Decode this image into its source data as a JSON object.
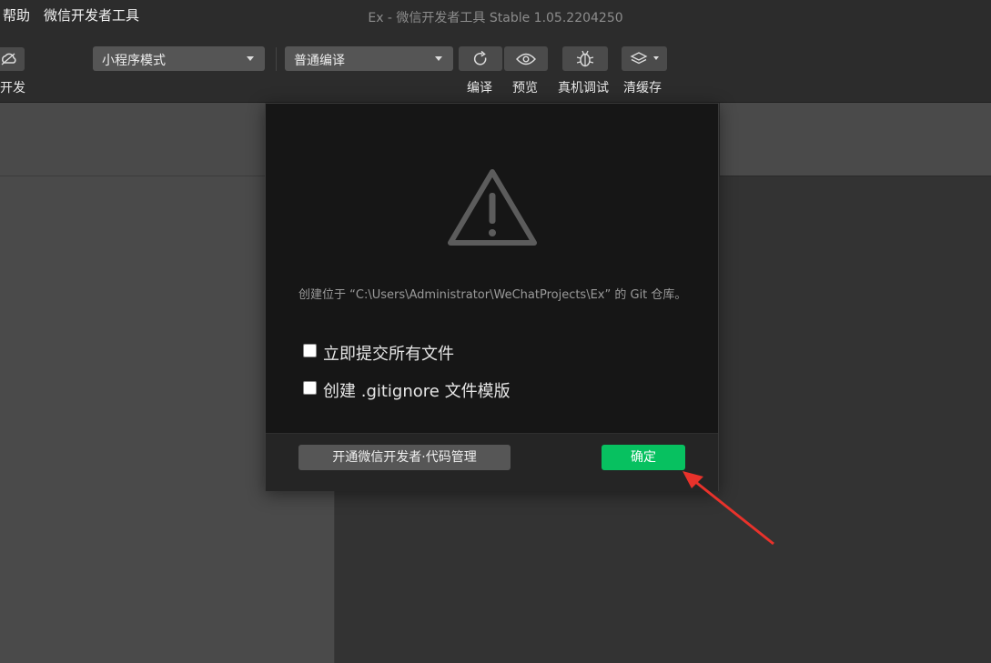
{
  "menu": {
    "help_label": "帮助",
    "devtools_label": "微信开发者工具"
  },
  "window": {
    "title": "Ex - 微信开发者工具 Stable 1.05.2204250"
  },
  "toolbar": {
    "left_partial_label": "开发",
    "mode_select": {
      "selected": "小程序模式"
    },
    "compile_select": {
      "selected": "普通编译"
    },
    "compile_label": "编译",
    "preview_label": "预览",
    "device_debug_label": "真机调试",
    "clear_cache_label": "清缓存"
  },
  "dialog": {
    "message": "创建位于 “C:\\Users\\Administrator\\WeChatProjects\\Ex” 的 Git 仓库。",
    "checkbox_commit_label": "立即提交所有文件",
    "checkbox_commit_checked": false,
    "checkbox_gitignore_label": "创建 .gitignore 文件模版",
    "checkbox_gitignore_checked": false,
    "code_mgmt_button_label": "开通微信开发者·代码管理",
    "ok_button_label": "确定"
  },
  "colors": {
    "accent_green": "#07c160",
    "annotation_red": "#e8322b",
    "warning_icon": "#5a5a5a"
  },
  "icons": [
    "cloud-icon",
    "caret-down-icon",
    "refresh-icon",
    "eye-icon",
    "bug-icon",
    "layers-icon",
    "warning-icon"
  ]
}
